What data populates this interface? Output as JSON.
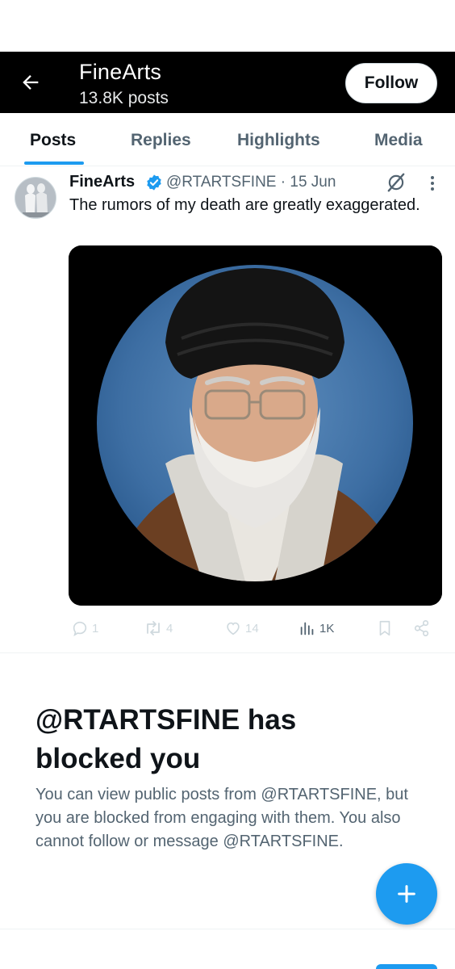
{
  "header": {
    "back_icon": "arrow-left-icon",
    "title": "FineArts",
    "post_count": "13.8K posts",
    "follow_label": "Follow"
  },
  "tabs": [
    {
      "label": "Posts",
      "active": true
    },
    {
      "label": "Replies",
      "active": false
    },
    {
      "label": "Highlights",
      "active": false
    },
    {
      "label": "Media",
      "active": false
    }
  ],
  "post": {
    "author_name": "FineArts",
    "verified_icon": "verified-badge-icon",
    "handle": "@RTARTSFINE",
    "separator": "·",
    "date": "15 Jun",
    "text": "The rumors of my death are greatly exaggerated.",
    "grok_icon": "grok-icon",
    "more_icon": "more-vertical-icon",
    "image_alt": "Portrait photo in circular frame",
    "stats": {
      "replies": "1",
      "reposts": "4",
      "likes": "14",
      "views": "1K"
    }
  },
  "blocked_notice": {
    "title": "@RTARTSFINE has blocked you",
    "body": "You can view public posts from @RTARTSFINE, but you are blocked from engaging with them. You also cannot follow or message @RTARTSFINE."
  },
  "fab": {
    "icon": "plus-icon"
  },
  "colors": {
    "accent": "#1d9bf0",
    "text_primary": "#0f1419",
    "text_secondary": "#536471",
    "header_bg": "#000000"
  }
}
